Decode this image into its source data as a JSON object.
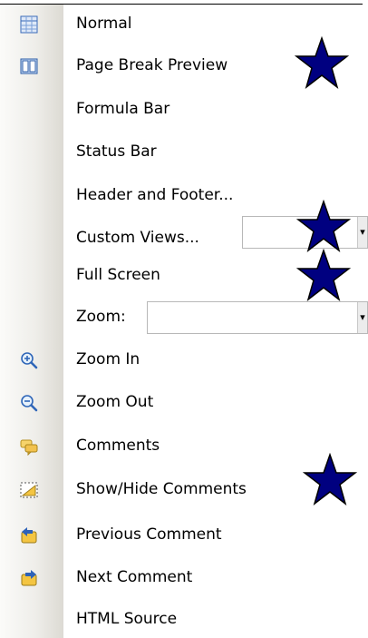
{
  "menu": {
    "items": [
      {
        "label": "Normal",
        "icon": "normal-view-icon"
      },
      {
        "label": "Page Break Preview",
        "icon": "page-break-preview-icon"
      },
      {
        "label": "Formula Bar"
      },
      {
        "label": "Status Bar"
      },
      {
        "label": "Header and Footer..."
      },
      {
        "label": "Custom Views..."
      },
      {
        "label": "Full Screen"
      },
      {
        "label": "Zoom:"
      },
      {
        "label": "Zoom In",
        "icon": "zoom-in-icon"
      },
      {
        "label": "Zoom Out",
        "icon": "zoom-out-icon"
      },
      {
        "label": "Comments",
        "icon": "comments-icon"
      },
      {
        "label": "Show/Hide Comments",
        "icon": "show-hide-comments-icon"
      },
      {
        "label": "Previous Comment",
        "icon": "previous-comment-icon"
      },
      {
        "label": "Next Comment",
        "icon": "next-comment-icon"
      },
      {
        "label": "HTML Source"
      }
    ],
    "custom_views_value": "",
    "zoom_value": ""
  },
  "colors": {
    "star_fill": "#000080",
    "icon_blue": "#2e62b8",
    "icon_yellow": "#f4c542"
  }
}
